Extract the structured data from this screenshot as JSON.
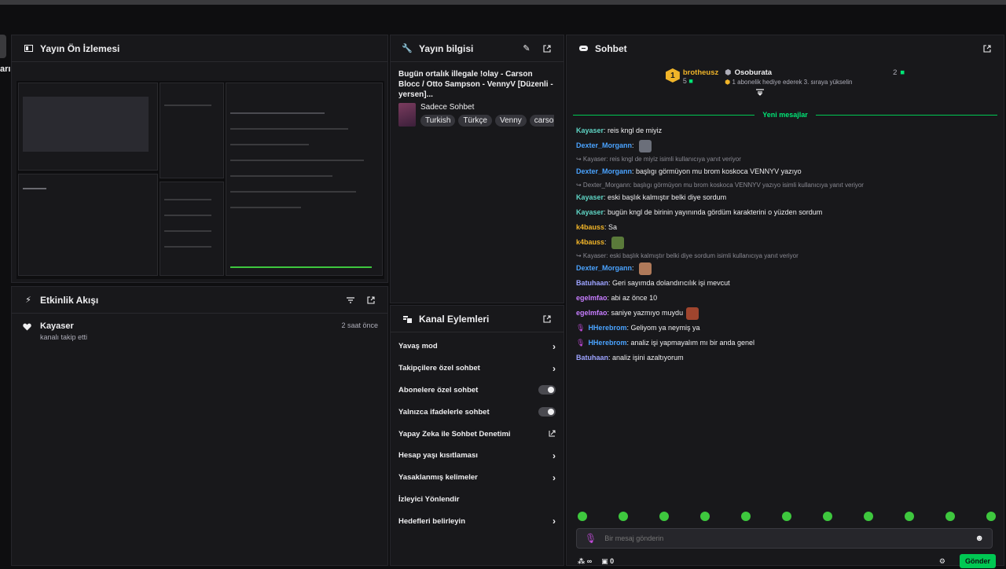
{
  "left_stub_label": "arı",
  "preview": {
    "title": "Yayın Ön İzlemesi"
  },
  "events": {
    "title": "Etkinlik Akışı",
    "items": [
      {
        "name": "Kayaser",
        "text": "kanalı takip etti",
        "time": "2 saat önce"
      }
    ]
  },
  "info": {
    "title": "Yayın bilgisi",
    "stream_title": "Bugün ortalık illegale !olay - Carson Blocc / Otto Sampson - VennyV [Düzenli -yersen]...",
    "category": "Sadece Sohbet",
    "tags": [
      "Turkish",
      "Türkçe",
      "Venny",
      "carsonblc"
    ]
  },
  "actions": {
    "title": "Kanal Eylemleri",
    "items": [
      {
        "label": "Yavaş mod",
        "type": "arrow"
      },
      {
        "label": "Takipçilere özel sohbet",
        "type": "arrow"
      },
      {
        "label": "Abonelere özel sohbet",
        "type": "toggle"
      },
      {
        "label": "Yalnızca ifadelerle sohbet",
        "type": "toggle"
      },
      {
        "label": "Yapay Zeka ile Sohbet Denetimi",
        "type": "external"
      },
      {
        "label": "Hesap yaşı kısıtlaması",
        "type": "arrow"
      },
      {
        "label": "Yasaklanmış kelimeler",
        "type": "arrow"
      },
      {
        "label": "İzleyici Yönlendir",
        "type": "none"
      },
      {
        "label": "Hedefleri belirleyin",
        "type": "arrow"
      }
    ]
  },
  "chat": {
    "title": "Sohbet",
    "pinned": {
      "rank": "1",
      "user": "brotheusz",
      "user_count": "5",
      "gifter": "Osoburata",
      "gifter_count": "2",
      "gift_text": "1 abonelik hediye ederek 3. sıraya yükselin"
    },
    "new_messages_label": "Yeni mesajlar",
    "messages": [
      {
        "user": "Kayaser",
        "color": "#5fd4c4",
        "text": "reis kngl de miyiz"
      },
      {
        "user": "Dexter_Morgann",
        "color": "#4aa3ff",
        "text": "",
        "emote": "#6b6f7a"
      },
      {
        "reply": "Kayaser: reis kngl de miyiz isimli kullanıcıya yanıt veriyor",
        "user": "Dexter_Morgann",
        "color": "#4aa3ff",
        "text": "başlıgı görmüyon mu brom koskoca VENNYV yazıyo"
      },
      {
        "reply": "Dexter_Morgann: başlıgı görmüyon mu brom koskoca VENNYV yazıyo isimli kullanıcıya yanıt veriyor",
        "user": "Kayaser",
        "color": "#5fd4c4",
        "text": "eski başlık kalmıştır belki diye sordum"
      },
      {
        "user": "Kayaser",
        "color": "#5fd4c4",
        "text": "bugün kngl de birinin yayınında gördüm karakterini o yüzden sordum"
      },
      {
        "user": "k4bauss",
        "color": "#f0b429",
        "text": "Sa"
      },
      {
        "user": "k4bauss",
        "color": "#f0b429",
        "text": "",
        "emote": "#5a7a3a"
      },
      {
        "reply": "Kayaser: eski başlık kalmıştır belki diye sordum isimli kullanıcıya yanıt veriyor",
        "user": "Dexter_Morgann",
        "color": "#4aa3ff",
        "text": "",
        "emote": "#b07a5a"
      },
      {
        "user": "Batuhaan",
        "color": "#9da3ff",
        "text": "Geri sayımda dolandırıcılık işi mevcut"
      },
      {
        "user": "egelmfao",
        "color": "#c77dff",
        "text": "abi az önce 10"
      },
      {
        "user": "egelmfao",
        "color": "#c77dff",
        "text": "saniye yazmıyo muydu",
        "emote": "#a0452e"
      },
      {
        "user": "HHerebrom",
        "color": "#4aa3ff",
        "text": "Geliyom ya neymiş ya",
        "mic": true
      },
      {
        "user": "HHerebrom",
        "color": "#4aa3ff",
        "text": "analiz işi yapmayalım mı bir anda genel",
        "mic": true
      },
      {
        "user": "Batuhaan",
        "color": "#9da3ff",
        "text": "analiz işini azaltıyorum"
      }
    ],
    "input_placeholder": "Bir mesaj gönderin",
    "viewers_icon_label": "∞",
    "count": "0",
    "send_label": "Gönder"
  },
  "colors": {
    "accent": "#00c853",
    "panel": "#18181b",
    "bg": "#0e0e10"
  }
}
